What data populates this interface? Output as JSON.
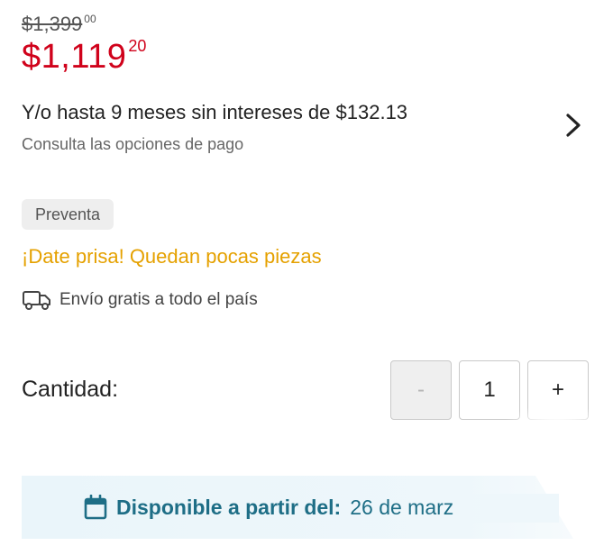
{
  "price": {
    "original_main": "$1,399",
    "original_cents": "00",
    "current_main": "$1,119",
    "current_cents": "20"
  },
  "installments": {
    "text": "Y/o hasta 9 meses sin intereses de $132.13",
    "link_label": "Consulta las opciones de pago"
  },
  "badge": {
    "label": "Preventa"
  },
  "stock_alert": "¡Date prisa! Quedan pocas piezas",
  "shipping": {
    "icon": "truck-icon",
    "label": "Envío gratis a todo el país"
  },
  "quantity": {
    "label": "Cantidad:",
    "minus_label": "-",
    "value": "1",
    "plus_label": "+"
  },
  "availability": {
    "icon": "calendar-icon",
    "label": "Disponible a partir del:",
    "date": "26 de marz"
  },
  "colors": {
    "price_red": "#d0021b",
    "alert_orange": "#e5a100",
    "availability_teal": "#1e6e86"
  }
}
